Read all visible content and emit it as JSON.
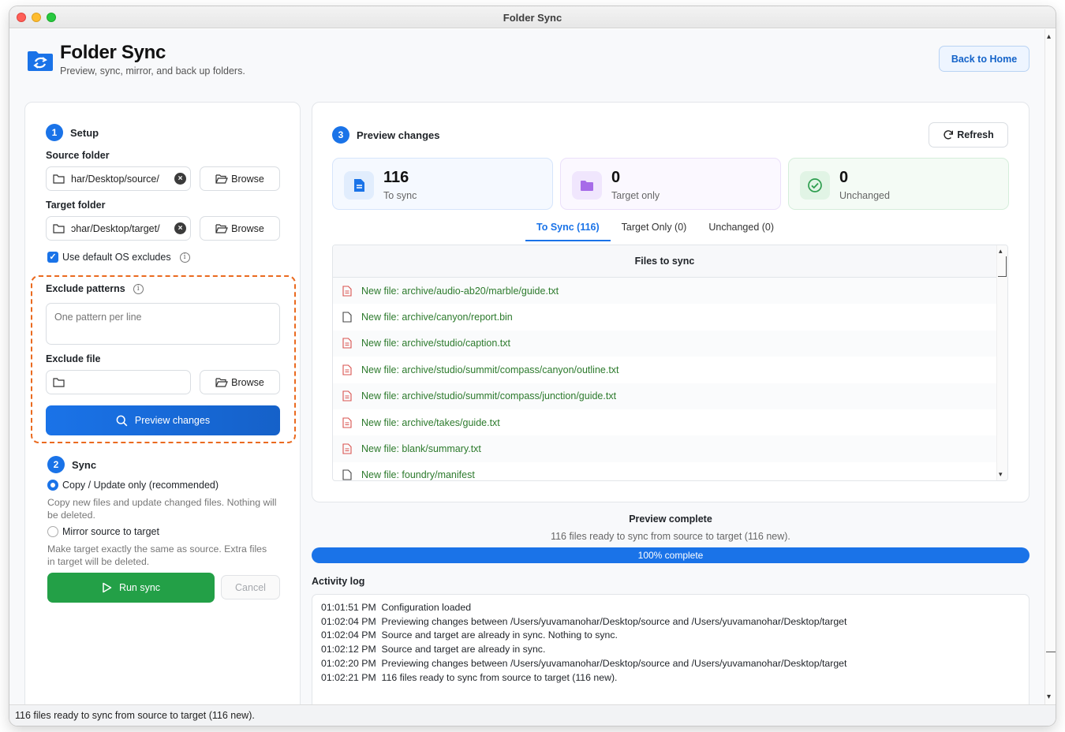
{
  "window": {
    "title": "Folder Sync"
  },
  "header": {
    "title": "Folder Sync",
    "subtitle": "Preview, sync, mirror, and back up folders.",
    "back_button": "Back to Home"
  },
  "setup": {
    "step_number": "1",
    "title": "Setup",
    "source_label": "Source folder",
    "source_value": "har/Desktop/source/",
    "target_label": "Target folder",
    "target_value": "ɔhar/Desktop/target/",
    "browse_label": "Browse",
    "default_excludes_label": "Use default OS excludes",
    "default_excludes_checked": true,
    "exclude_patterns_label": "Exclude patterns",
    "exclude_patterns_placeholder": "One pattern per line",
    "exclude_file_label": "Exclude file",
    "exclude_file_value": "",
    "preview_button": "Preview changes",
    "highlight_color": "#ea6a1f"
  },
  "sync": {
    "step_number": "2",
    "title": "Sync",
    "options": [
      {
        "label": "Copy / Update only (recommended)",
        "description": "Copy new files and update changed files. Nothing will be deleted.",
        "selected": true
      },
      {
        "label": "Mirror source to target",
        "description": "Make target exactly the same as source. Extra files in target will be deleted.",
        "selected": false
      }
    ],
    "run_button": "Run sync",
    "cancel_button": "Cancel"
  },
  "preview": {
    "step_number": "3",
    "title": "Preview changes",
    "refresh_button": "Refresh",
    "stats": [
      {
        "value": "116",
        "label": "To sync",
        "icon": "document-icon",
        "color": "#1a73e8"
      },
      {
        "value": "0",
        "label": "Target only",
        "icon": "folder-icon",
        "color": "#9b5de5"
      },
      {
        "value": "0",
        "label": "Unchanged",
        "icon": "check-circle-icon",
        "color": "#2e9e4f"
      }
    ],
    "tabs": [
      "To Sync (116)",
      "Target Only (0)",
      "Unchanged (0)"
    ],
    "active_tab": 0,
    "list_header": "Files to sync",
    "files": [
      {
        "text": "New file: archive/audio-ab20/marble/guide.txt",
        "icon": "text-file-icon"
      },
      {
        "text": "New file: archive/canyon/report.bin",
        "icon": "blank-file-icon"
      },
      {
        "text": "New file: archive/studio/caption.txt",
        "icon": "text-file-icon"
      },
      {
        "text": "New file: archive/studio/summit/compass/canyon/outline.txt",
        "icon": "text-file-icon"
      },
      {
        "text": "New file: archive/studio/summit/compass/junction/guide.txt",
        "icon": "text-file-icon"
      },
      {
        "text": "New file: archive/takes/guide.txt",
        "icon": "text-file-icon"
      },
      {
        "text": "New file: blank/summary.txt",
        "icon": "text-file-icon"
      },
      {
        "text": "New file: foundry/manifest",
        "icon": "blank-file-icon"
      }
    ]
  },
  "status": {
    "title": "Preview complete",
    "detail": "116 files ready to sync from source to target (116 new).",
    "progress_percent": 100,
    "progress_label": "100% complete"
  },
  "activity_log": {
    "title": "Activity log",
    "entries": [
      "01:01:51 PM  Configuration loaded",
      "01:02:04 PM  Previewing changes between /Users/yuvamanohar/Desktop/source and /Users/yuvamanohar/Desktop/target",
      "01:02:04 PM  Source and target are already in sync. Nothing to sync.",
      "01:02:12 PM  Source and target are already in sync.",
      "01:02:20 PM  Previewing changes between /Users/yuvamanohar/Desktop/source and /Users/yuvamanohar/Desktop/target",
      "01:02:21 PM  116 files ready to sync from source to target (116 new)."
    ]
  },
  "statusbar": {
    "text": "116 files ready to sync from source to target (116 new)."
  }
}
